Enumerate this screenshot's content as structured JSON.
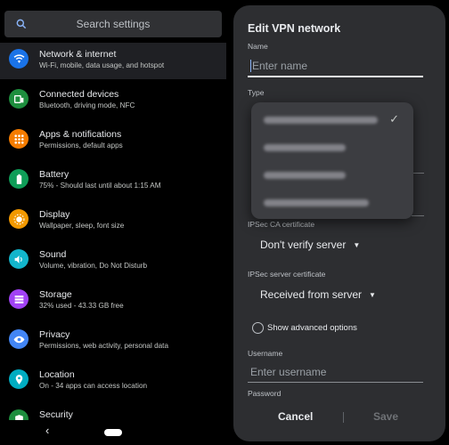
{
  "search": {
    "placeholder": "Search settings",
    "icon": "search-icon"
  },
  "settings_items": [
    {
      "title": "Network & internet",
      "subtitle": "Wi-Fi, mobile, data usage, and hotspot",
      "color": "#1a73e8",
      "icon": "wifi-icon",
      "selected": true
    },
    {
      "title": "Connected devices",
      "subtitle": "Bluetooth, driving mode, NFC",
      "color": "#1e8e3e",
      "icon": "devices-icon"
    },
    {
      "title": "Apps & notifications",
      "subtitle": "Permissions, default apps",
      "color": "#f57c00",
      "icon": "apps-icon"
    },
    {
      "title": "Battery",
      "subtitle": "75% - Should last until about 1:15 AM",
      "color": "#0f9d58",
      "icon": "battery-icon"
    },
    {
      "title": "Display",
      "subtitle": "Wallpaper, sleep, font size",
      "color": "#f29900",
      "icon": "brightness-icon"
    },
    {
      "title": "Sound",
      "subtitle": "Volume, vibration, Do Not Disturb",
      "color": "#12b5cb",
      "icon": "volume-icon"
    },
    {
      "title": "Storage",
      "subtitle": "32% used - 43.33 GB free",
      "color": "#a142f4",
      "icon": "storage-icon"
    },
    {
      "title": "Privacy",
      "subtitle": "Permissions, web activity, personal data",
      "color": "#4285f4",
      "icon": "eye-icon"
    },
    {
      "title": "Location",
      "subtitle": "On - 34 apps can access location",
      "color": "#00acc1",
      "icon": "location-pin-icon"
    },
    {
      "title": "Security",
      "subtitle": "",
      "color": "#1e8e3e",
      "icon": "shield-icon"
    }
  ],
  "navbar": {
    "back_glyph": "‹"
  },
  "dialog": {
    "title": "Edit VPN network",
    "name_label": "Name",
    "name_placeholder": "Enter name",
    "type_label": "Type",
    "ca_label": "IPSec CA certificate",
    "ca_value": "Don't verify server",
    "server_label": "IPSec server certificate",
    "server_value": "Received from server",
    "advanced_label": "Show advanced options",
    "username_label": "Username",
    "username_placeholder": "Enter username",
    "password_label": "Password",
    "cancel_label": "Cancel",
    "save_label": "Save"
  },
  "type_popup": {
    "option_count": 4,
    "selected_index": 0,
    "check_glyph": "✓"
  },
  "colors": {
    "accent": "#8ab4f8",
    "dialog_bg": "#2d2e31",
    "popup_bg": "#3c3d41"
  }
}
